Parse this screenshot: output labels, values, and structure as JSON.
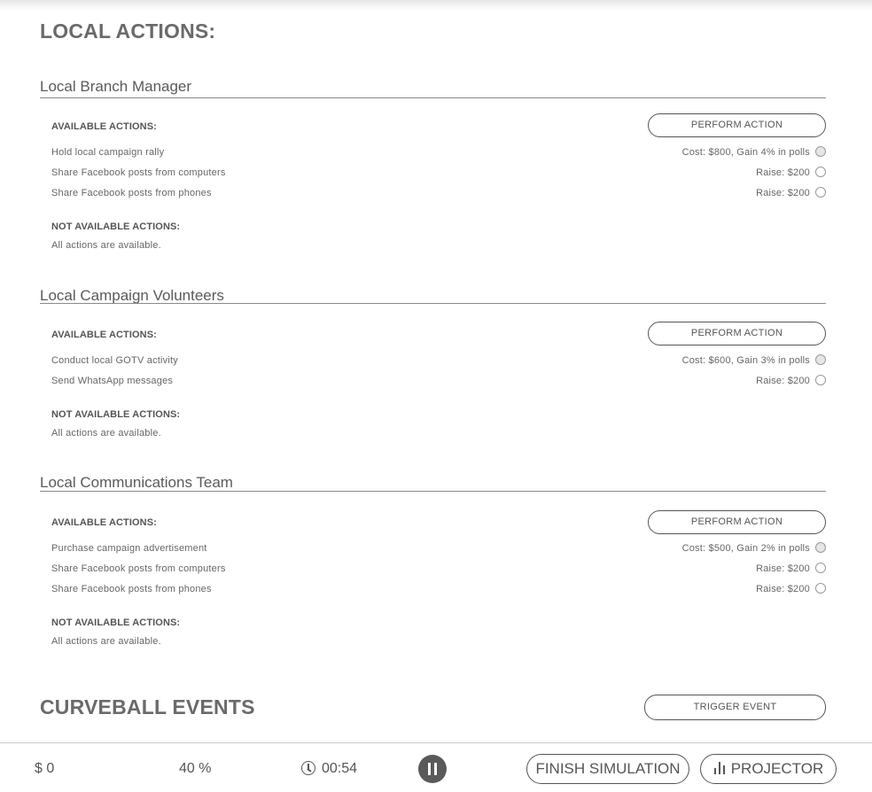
{
  "page": {
    "heading": "LOCAL ACTIONS:"
  },
  "sections": [
    {
      "title": "Local Branch Manager",
      "available_label": "AVAILABLE ACTIONS:",
      "perform_label": "PERFORM ACTION",
      "actions": [
        {
          "name": "Hold local campaign rally",
          "meta": "Cost: $800, Gain 4% in polls",
          "selected": false
        },
        {
          "name": "Share Facebook posts from computers",
          "meta": "Raise: $200",
          "selected": false
        },
        {
          "name": "Share Facebook posts from phones",
          "meta": "Raise: $200",
          "selected": false
        }
      ],
      "not_available_label": "NOT AVAILABLE ACTIONS:",
      "not_available_text": "All actions are available."
    },
    {
      "title": "Local Campaign Volunteers",
      "available_label": "AVAILABLE ACTIONS:",
      "perform_label": "PERFORM ACTION",
      "actions": [
        {
          "name": "Conduct local GOTV activity",
          "meta": "Cost: $600, Gain 3% in polls",
          "selected": false
        },
        {
          "name": "Send WhatsApp messages",
          "meta": "Raise: $200",
          "selected": false
        }
      ],
      "not_available_label": "NOT AVAILABLE ACTIONS:",
      "not_available_text": "All actions are available."
    },
    {
      "title": "Local Communications Team",
      "available_label": "AVAILABLE ACTIONS:",
      "perform_label": "PERFORM ACTION",
      "actions": [
        {
          "name": "Purchase campaign advertisement",
          "meta": "Cost: $500, Gain 2% in polls",
          "selected": false
        },
        {
          "name": "Share Facebook posts from computers",
          "meta": "Raise: $200",
          "selected": false
        },
        {
          "name": "Share Facebook posts from phones",
          "meta": "Raise: $200",
          "selected": false
        }
      ],
      "not_available_label": "NOT AVAILABLE ACTIONS:",
      "not_available_text": "All actions are available."
    }
  ],
  "curveball": {
    "heading": "CURVEBALL EVENTS",
    "trigger_label": "TRIGGER EVENT"
  },
  "bottom_bar": {
    "money": "$ 0",
    "polls": "40 %",
    "timer": "00:54",
    "finish_label": "FINISH SIMULATION",
    "projector_label": "PROJECTOR"
  },
  "icons": {
    "timer": "clock-icon",
    "pause": "pause-icon",
    "projector": "bar-chart-icon"
  }
}
